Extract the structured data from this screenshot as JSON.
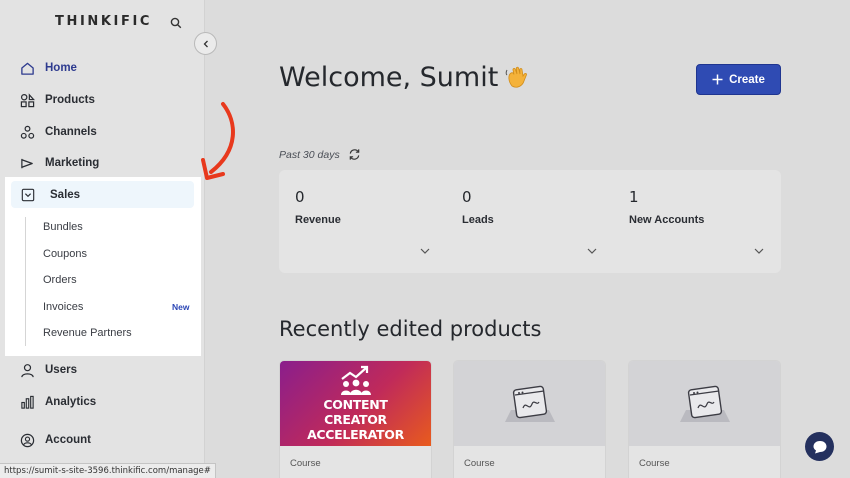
{
  "sidebar": {
    "brand": "THINKIFIC",
    "items": [
      {
        "label": "Home"
      },
      {
        "label": "Products"
      },
      {
        "label": "Channels"
      },
      {
        "label": "Marketing"
      },
      {
        "label": "Sales"
      },
      {
        "label": "Users"
      },
      {
        "label": "Analytics"
      },
      {
        "label": "Account"
      }
    ],
    "sales_subitems": [
      {
        "label": "Bundles"
      },
      {
        "label": "Coupons"
      },
      {
        "label": "Orders"
      },
      {
        "label": "Invoices",
        "badge": "New"
      },
      {
        "label": "Revenue Partners"
      }
    ]
  },
  "status_bar": {
    "url": "https://sumit-s-site-3596.thinkific.com/manage#"
  },
  "main": {
    "welcome": "Welcome, Sumit",
    "create_label": "Create",
    "period": "Past 30 days",
    "stats": [
      {
        "value": "0",
        "label": "Revenue"
      },
      {
        "value": "0",
        "label": "Leads"
      },
      {
        "value": "1",
        "label": "New Accounts"
      }
    ],
    "recent_title": "Recently edited products",
    "products": [
      {
        "thumb_text": "CONTENT CREATOR ACCELERATOR",
        "type": "Course"
      },
      {
        "type": "Course"
      },
      {
        "type": "Course"
      }
    ]
  },
  "colors": {
    "accent": "#2f4bb3",
    "annotation_arrow": "#e8391d",
    "active_nav": "#2e3b8f"
  },
  "icons": [
    "search-icon",
    "chevron-left-icon",
    "home-icon",
    "products-icon",
    "channels-icon",
    "marketing-icon",
    "sales-icon",
    "users-icon",
    "analytics-icon",
    "account-icon",
    "plus-icon",
    "refresh-icon",
    "chevron-down-icon",
    "chat-icon",
    "waving-hand-icon"
  ]
}
